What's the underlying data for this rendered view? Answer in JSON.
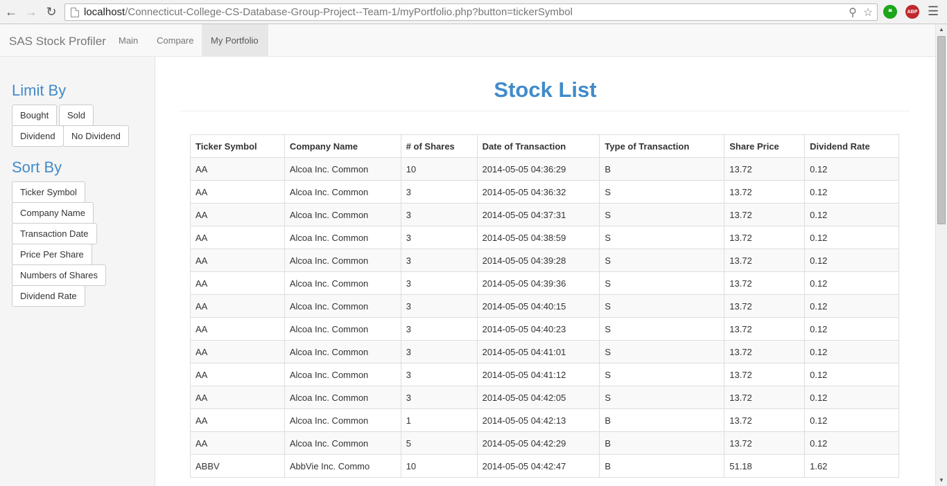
{
  "browser": {
    "url_host": "localhost",
    "url_path": "/Connecticut-College-CS-Database-Group-Project--Team-1/myPortfolio.php?button=tickerSymbol",
    "abp_label": "ABP"
  },
  "navbar": {
    "brand": "SAS Stock Profiler",
    "links": [
      {
        "label": "Main"
      },
      {
        "label": "Compare"
      },
      {
        "label": "My Portfolio"
      }
    ]
  },
  "sidebar": {
    "limit_heading": "Limit By",
    "limit_buttons": [
      "Bought",
      "Sold",
      "Dividend",
      "No Dividend"
    ],
    "sort_heading": "Sort By",
    "sort_buttons": [
      "Ticker Symbol",
      "Company Name",
      "Transaction Date",
      "Price Per Share",
      "Numbers of Shares",
      "Dividend Rate"
    ]
  },
  "main": {
    "title": "Stock List",
    "columns": [
      "Ticker Symbol",
      "Company Name",
      "# of Shares",
      "Date of Transaction",
      "Type of Transaction",
      "Share Price",
      "Dividend Rate"
    ],
    "rows": [
      [
        "AA",
        "Alcoa Inc. Common",
        "10",
        "2014-05-05 04:36:29",
        "B",
        "13.72",
        "0.12"
      ],
      [
        "AA",
        "Alcoa Inc. Common",
        "3",
        "2014-05-05 04:36:32",
        "S",
        "13.72",
        "0.12"
      ],
      [
        "AA",
        "Alcoa Inc. Common",
        "3",
        "2014-05-05 04:37:31",
        "S",
        "13.72",
        "0.12"
      ],
      [
        "AA",
        "Alcoa Inc. Common",
        "3",
        "2014-05-05 04:38:59",
        "S",
        "13.72",
        "0.12"
      ],
      [
        "AA",
        "Alcoa Inc. Common",
        "3",
        "2014-05-05 04:39:28",
        "S",
        "13.72",
        "0.12"
      ],
      [
        "AA",
        "Alcoa Inc. Common",
        "3",
        "2014-05-05 04:39:36",
        "S",
        "13.72",
        "0.12"
      ],
      [
        "AA",
        "Alcoa Inc. Common",
        "3",
        "2014-05-05 04:40:15",
        "S",
        "13.72",
        "0.12"
      ],
      [
        "AA",
        "Alcoa Inc. Common",
        "3",
        "2014-05-05 04:40:23",
        "S",
        "13.72",
        "0.12"
      ],
      [
        "AA",
        "Alcoa Inc. Common",
        "3",
        "2014-05-05 04:41:01",
        "S",
        "13.72",
        "0.12"
      ],
      [
        "AA",
        "Alcoa Inc. Common",
        "3",
        "2014-05-05 04:41:12",
        "S",
        "13.72",
        "0.12"
      ],
      [
        "AA",
        "Alcoa Inc. Common",
        "3",
        "2014-05-05 04:42:05",
        "S",
        "13.72",
        "0.12"
      ],
      [
        "AA",
        "Alcoa Inc. Common",
        "1",
        "2014-05-05 04:42:13",
        "B",
        "13.72",
        "0.12"
      ],
      [
        "AA",
        "Alcoa Inc. Common",
        "5",
        "2014-05-05 04:42:29",
        "B",
        "13.72",
        "0.12"
      ],
      [
        "ABBV",
        "AbbVie Inc. Commo",
        "10",
        "2014-05-05 04:42:47",
        "B",
        "51.18",
        "1.62"
      ]
    ]
  }
}
